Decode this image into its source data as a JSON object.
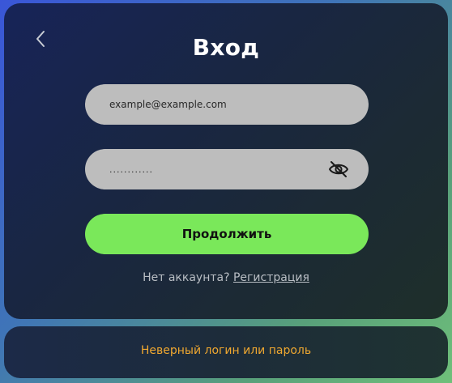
{
  "login": {
    "title": "Вход",
    "email_placeholder": "example@example.com",
    "password_value": "............",
    "continue_label": "Продолжить",
    "no_account_text": "Нет аккаунта?",
    "register_link": "Регистрация"
  },
  "error": {
    "message": "Неверный логин или пароль"
  },
  "icons": {
    "back": "chevron-left-icon",
    "toggle_password": "eye-off-icon"
  },
  "colors": {
    "primary_button": "#7ae85a",
    "input_background": "#bdbdbd",
    "error_text": "#f0a830"
  }
}
